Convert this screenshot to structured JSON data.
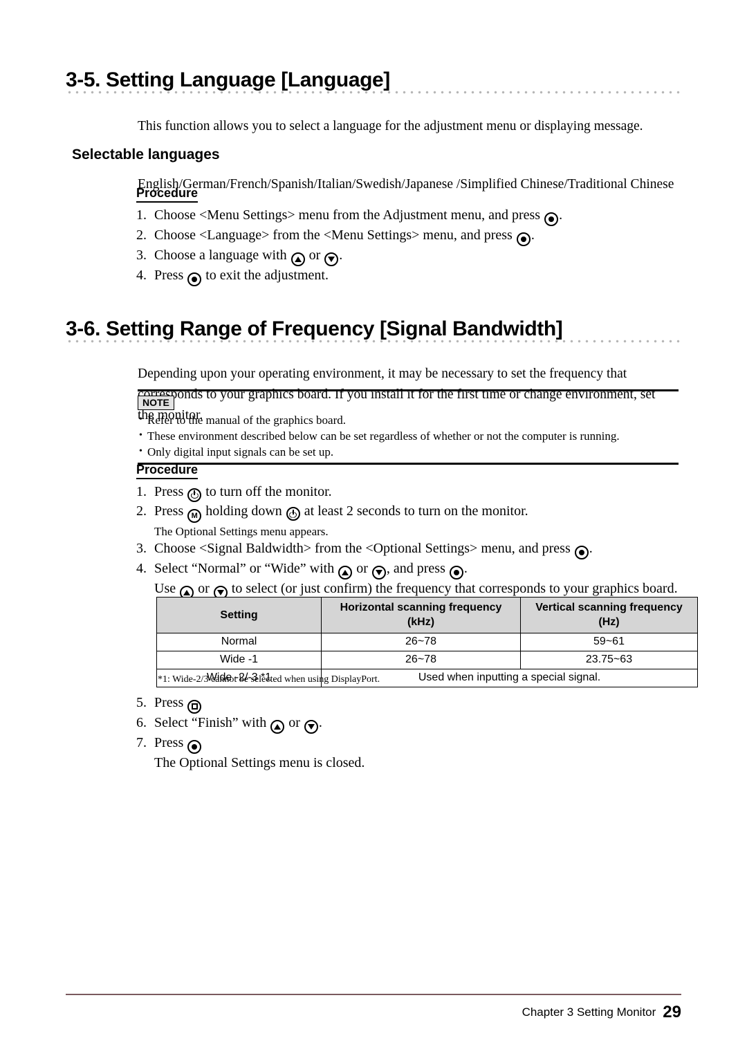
{
  "section_35": {
    "heading": "3-5. Setting Language [Language]",
    "intro": "This function allows you to select a language for the adjustment menu or displaying message.",
    "subheading": "Selectable languages",
    "languages": "English/German/French/Spanish/Italian/Swedish/Japanese /Simplified Chinese/Traditional Chinese",
    "procedure_label": "Procedure",
    "steps": [
      {
        "num": "1.",
        "parts": [
          "Choose <Menu Settings> menu from the Adjustment menu, and press ",
          {
            "icon": "enter-key-icon"
          },
          "."
        ]
      },
      {
        "num": "2.",
        "parts": [
          "Choose <Language> from the <Menu Settings> menu, and press ",
          {
            "icon": "enter-key-icon"
          },
          "."
        ]
      },
      {
        "num": "3.",
        "parts": [
          "Choose a language with ",
          {
            "icon": "up-key-icon"
          },
          " or ",
          {
            "icon": "down-key-icon"
          },
          "."
        ]
      },
      {
        "num": "4.",
        "parts": [
          "Press ",
          {
            "icon": "enter-key-icon"
          },
          " to exit the adjustment."
        ]
      }
    ]
  },
  "section_36": {
    "heading": "3-6. Setting Range of Frequency [Signal Bandwidth]",
    "intro": "Depending upon your operating environment, it may be necessary to set the frequency that corresponds to your graphics board. If you install it for the first time or change environment, set the monitor.",
    "note_label": "NOTE",
    "notes": [
      "Refer to the manual of the graphics board.",
      "These environment described below can be set regardless of whether or not the computer is running.",
      "Only digital input signals can be set up."
    ],
    "procedure_label": "Procedure",
    "steps": [
      {
        "num": "1.",
        "text_before": "Press ",
        "icon": "power-key-icon",
        "text_after": " to turn off the monitor."
      },
      {
        "num": "2.",
        "text_before": "Press ",
        "icon": "mode-key-icon",
        "text_mid": " holding down ",
        "icon2": "power-key-icon",
        "text_after": " at least 2 seconds to turn on the monitor."
      },
      {
        "num": "2-note",
        "text": "The Optional Settings menu appears."
      },
      {
        "num": "3.",
        "text_before": "Choose <Signal Baldwidth> from the <Optional Settings> menu, and press ",
        "icon": "enter-key-icon",
        "text_after": "."
      },
      {
        "num": "4.",
        "text_before": "Select “Normal” or “Wide” with ",
        "icon": "up-key-icon",
        "text_mid": " or ",
        "icon2": "down-key-icon",
        "text_after": ", and press ",
        "icon3": "enter-key-icon",
        "text_end": "."
      },
      {
        "num": "4-sub",
        "text_before": "Use ",
        "icon": "up-key-icon",
        "text_mid": " or ",
        "icon2": "down-key-icon",
        "text_after": " to select (or just confirm) the frequency that corresponds to your graphics board."
      },
      {
        "num": "5.",
        "text_before": "Press ",
        "icon": "menu-key-icon",
        "text_after": ""
      },
      {
        "num": "6.",
        "text_before": "Select “Finish” with ",
        "icon": "up-key-icon",
        "text_mid": " or ",
        "icon2": "down-key-icon",
        "text_after": "."
      },
      {
        "num": "7.",
        "text_before": "Press ",
        "icon": "enter-key-icon",
        "text_after": ""
      },
      {
        "num": "7-note",
        "text": "The Optional Settings menu is closed."
      }
    ],
    "footnote": "*1: Wide-2/3 cannot be selected when using DisplayPort."
  },
  "table": {
    "headers": [
      "Setting",
      "Horizontal scanning frequency\n(kHz)",
      "Vertical scanning frequency\n(Hz)"
    ],
    "header_setting": "Setting",
    "header_h_line1": "Horizontal scanning frequency",
    "header_h_line2": "(kHz)",
    "header_v_line1": "Vertical scanning frequency",
    "header_v_line2": "(Hz)",
    "rows": [
      {
        "setting": "Normal",
        "horizontal": "26~78",
        "vertical": "59~61"
      },
      {
        "setting": "Wide -1",
        "horizontal": "26~78",
        "vertical": "23.75~63"
      },
      {
        "setting": "Wide -2/-3 *1",
        "merged": "Used when inputting a special signal."
      }
    ],
    "row1_setting": "Normal",
    "row1_h": "26~78",
    "row1_v": "59~61",
    "row2_setting": "Wide -1",
    "row2_h": "26~78",
    "row2_v": "23.75~63",
    "row3_setting": "Wide -2/-3 *1",
    "row3_merged": "Used when inputting a special signal."
  },
  "steps_text": {
    "s35_1a": "Choose <Menu Settings> menu from the Adjustment menu, and press ",
    "s35_1b": ".",
    "s35_2a": "Choose <Language> from the <Menu Settings> menu, and press ",
    "s35_2b": ".",
    "s35_3a": "Choose a language with ",
    "s35_3b": " or ",
    "s35_3c": ".",
    "s35_4a": "Press ",
    "s35_4b": " to exit the adjustment.",
    "s36_1a": "Press ",
    "s36_1b": " to turn off the monitor.",
    "s36_2a": "Press ",
    "s36_2b": " holding down ",
    "s36_2c": " at least 2 seconds to turn on the monitor.",
    "s36_2note": "The Optional Settings menu appears.",
    "s36_3a": "Choose <Signal Baldwidth> from the <Optional Settings> menu, and press ",
    "s36_3b": ".",
    "s36_4a": "Select “Normal” or “Wide” with ",
    "s36_4b": " or ",
    "s36_4c": ", and press ",
    "s36_4d": ".",
    "s36_4subA": "Use ",
    "s36_4subB": " or ",
    "s36_4subC": " to select (or just confirm) the frequency that corresponds to your graphics board.",
    "s36_5a": "Press ",
    "s36_6a": "Select “Finish” with ",
    "s36_6b": " or ",
    "s36_6c": ".",
    "s36_7a": "Press ",
    "s36_7note": "The Optional Settings menu is closed."
  },
  "numbers": {
    "n1": "1.",
    "n2": "2.",
    "n3": "3.",
    "n4": "4.",
    "n5": "5.",
    "n6": "6.",
    "n7": "7."
  },
  "footer": {
    "chapter": "Chapter 3  Setting Monitor",
    "page": "29"
  },
  "colors": {
    "footer_rule": "#7a5a5e",
    "table_header_bg": "#d5d5d5",
    "note_badge_bg": "#e3e3e3",
    "leader_dots": "#b6b6b6",
    "text": "#000000"
  }
}
